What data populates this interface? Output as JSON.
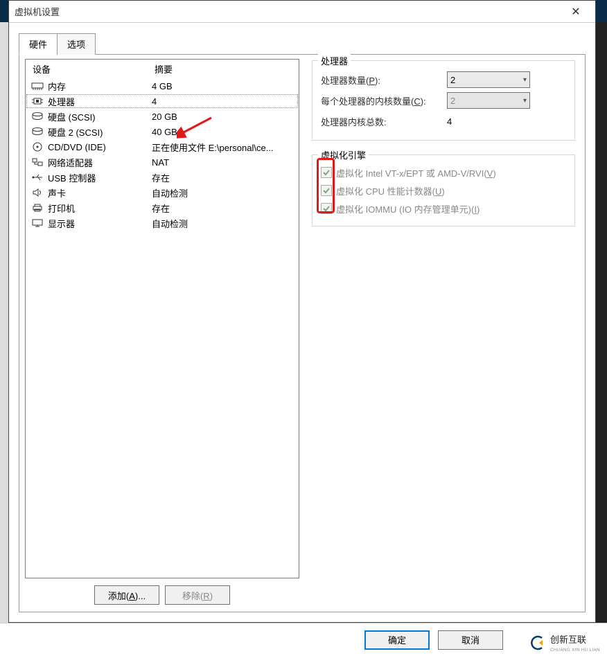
{
  "window": {
    "title": "虚拟机设置",
    "close": "✕"
  },
  "tabs": {
    "hardware": "硬件",
    "options": "选项"
  },
  "device_headers": {
    "device": "设备",
    "summary": "摘要"
  },
  "devices": [
    {
      "icon": "memory",
      "name": "内存",
      "summary": "4 GB",
      "selected": false
    },
    {
      "icon": "cpu",
      "name": "处理器",
      "summary": "4",
      "selected": true
    },
    {
      "icon": "hdd",
      "name": "硬盘 (SCSI)",
      "summary": "20 GB",
      "selected": false
    },
    {
      "icon": "hdd",
      "name": "硬盘 2 (SCSI)",
      "summary": "40 GB",
      "selected": false
    },
    {
      "icon": "cd",
      "name": "CD/DVD (IDE)",
      "summary": "正在使用文件 E:\\personal\\ce...",
      "selected": false
    },
    {
      "icon": "net",
      "name": "网络适配器",
      "summary": "NAT",
      "selected": false
    },
    {
      "icon": "usb",
      "name": "USB 控制器",
      "summary": "存在",
      "selected": false
    },
    {
      "icon": "sound",
      "name": "声卡",
      "summary": "自动检测",
      "selected": false
    },
    {
      "icon": "printer",
      "name": "打印机",
      "summary": "存在",
      "selected": false
    },
    {
      "icon": "display",
      "name": "显示器",
      "summary": "自动检测",
      "selected": false
    }
  ],
  "device_buttons": {
    "add": "添加(A)...",
    "remove": "移除(R)",
    "add_key": "A",
    "remove_key": "R"
  },
  "processor_group": {
    "title": "处理器",
    "count_label_pre": "处理器数量(",
    "count_key": "P",
    "count_label_post": "):",
    "cores_label_pre": "每个处理器的内核数量(",
    "cores_key": "C",
    "cores_label_post": "):",
    "total_label": "处理器内核总数:",
    "count_value": "2",
    "cores_value": "2",
    "total_value": "4"
  },
  "virt_group": {
    "title": "虚拟化引擎",
    "vt_label_pre": "虚拟化 Intel VT-x/EPT 或 AMD-V/RVI(",
    "vt_key": "V",
    "vt_post": ")",
    "perf_label_pre": "虚拟化 CPU 性能计数器(",
    "perf_key": "U",
    "perf_post": ")",
    "iommu_label_pre": "虚拟化 IOMMU (IO 内存管理单元)(",
    "iommu_key": "I",
    "iommu_post": ")"
  },
  "footer": {
    "ok": "确定",
    "cancel": "取消"
  },
  "watermark": {
    "text": "创新互联",
    "sub": "CHUANG XIN HU LIAN"
  }
}
